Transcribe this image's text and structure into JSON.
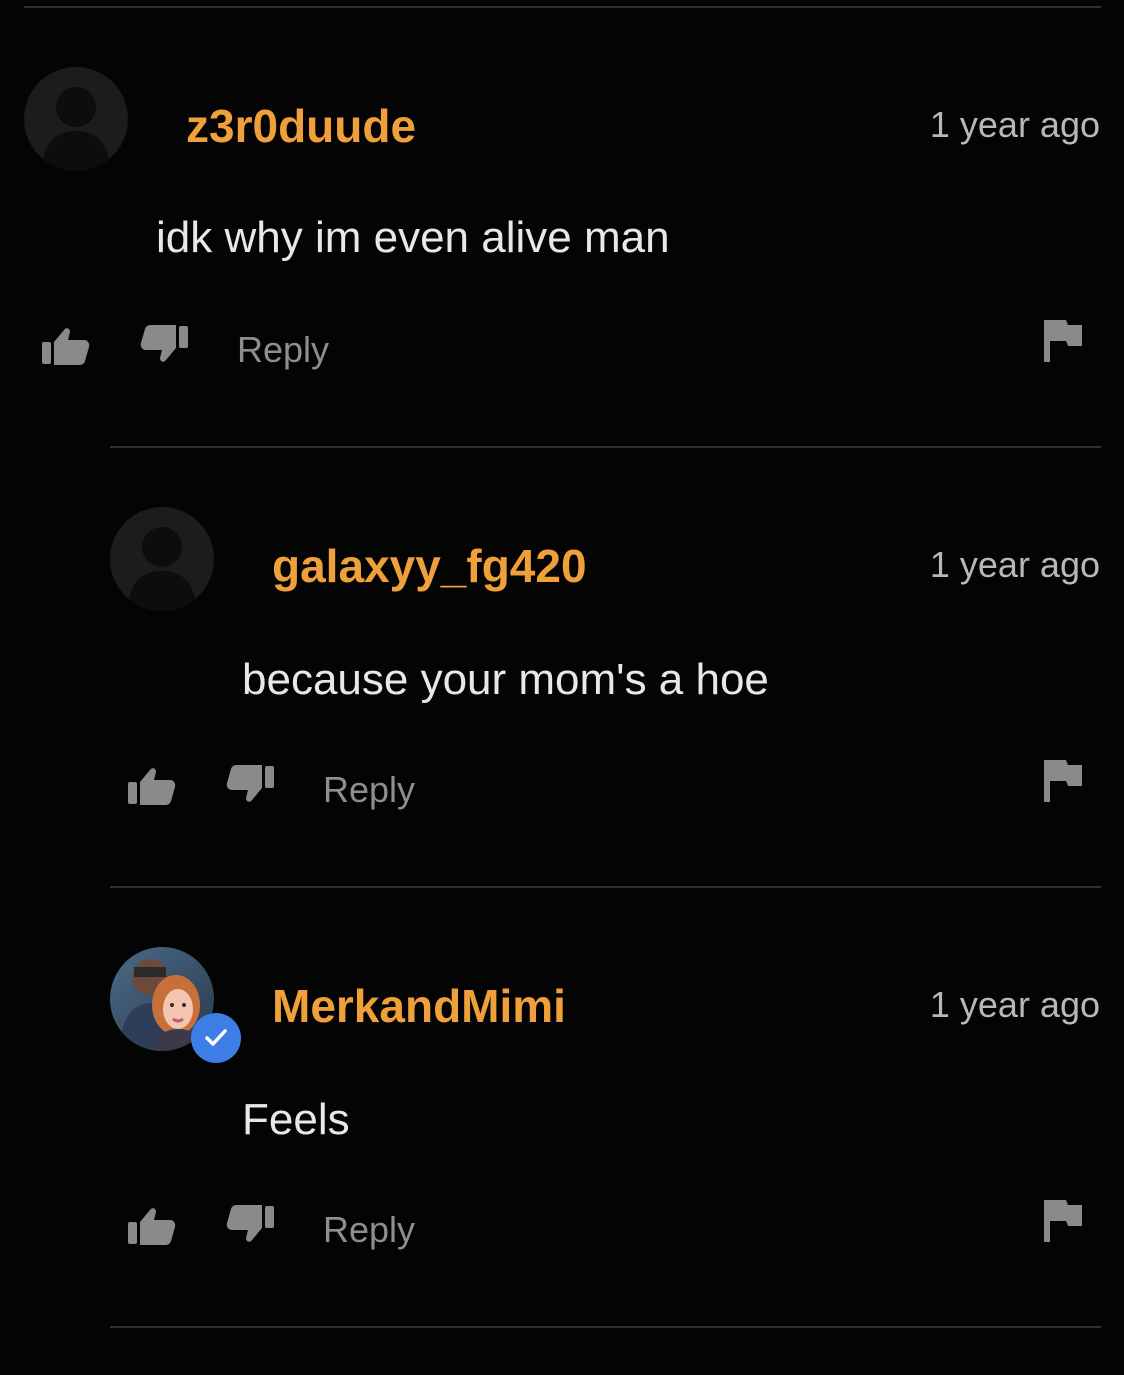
{
  "comments": [
    {
      "username": "z3r0duude",
      "time": "1 year ago",
      "text": "idk why im even alive man",
      "reply_label": "Reply",
      "avatar": "default-avatar",
      "verified": false
    },
    {
      "username": "galaxyy_fg420",
      "time": "1 year ago",
      "text": "because your mom's a hoe",
      "reply_label": "Reply",
      "avatar": "default-avatar",
      "verified": false
    },
    {
      "username": "MerkandMimi",
      "time": "1 year ago",
      "text": "Feels",
      "reply_label": "Reply",
      "avatar": "user-photo",
      "verified": true
    }
  ],
  "icons": {
    "like": "thumbs-up-icon",
    "dislike": "thumbs-down-icon",
    "flag": "flag-icon",
    "verified": "verified-check-icon"
  },
  "colors": {
    "background": "#040404",
    "username": "#f0a03a",
    "verified_badge": "#3d7de6",
    "icon": "#8a8a8a",
    "divider": "#2f2f2f"
  }
}
